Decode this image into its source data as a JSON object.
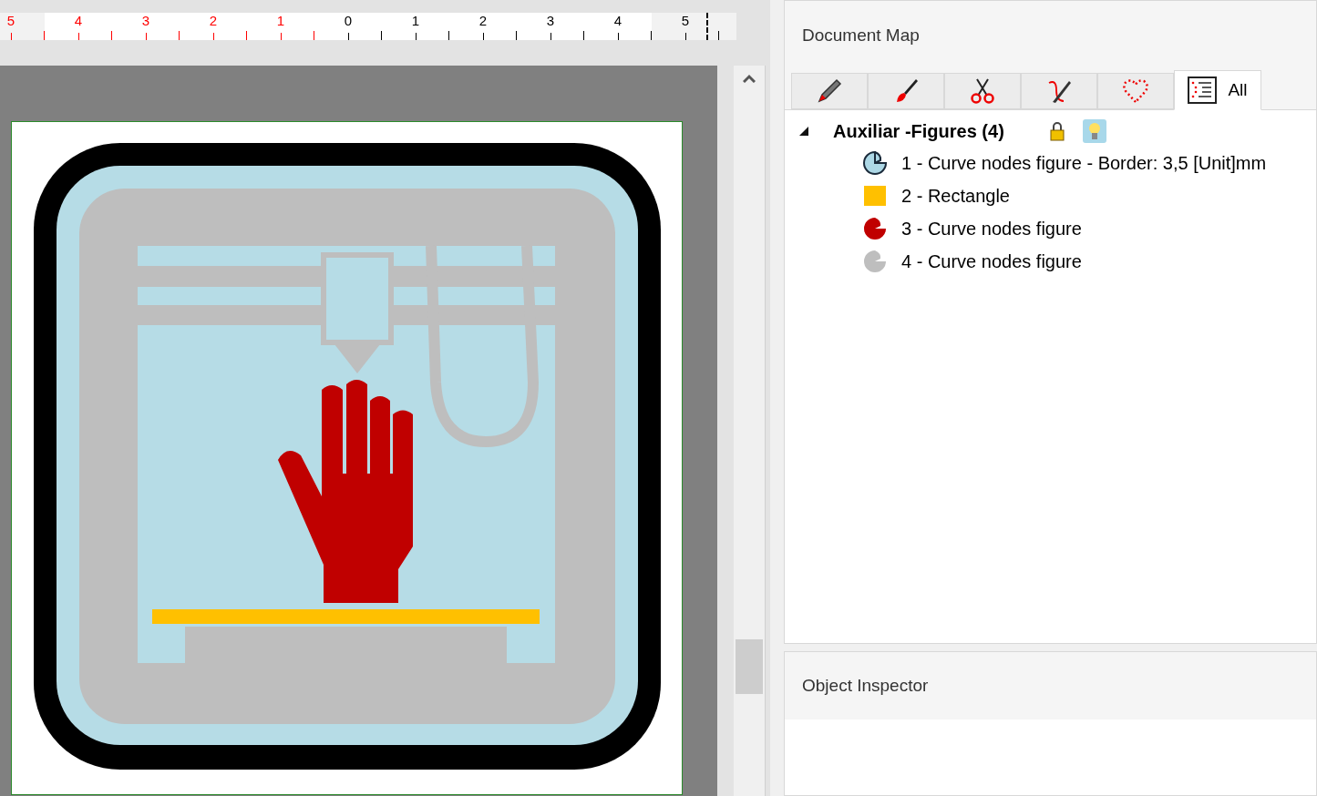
{
  "ruler": {
    "labels": [
      {
        "text": "5",
        "color": "#ff0000"
      },
      {
        "text": "4",
        "color": "#ff0000"
      },
      {
        "text": "3",
        "color": "#ff0000"
      },
      {
        "text": "2",
        "color": "#ff0000"
      },
      {
        "text": "1",
        "color": "#ff0000"
      },
      {
        "text": "0",
        "color": "#000000"
      },
      {
        "text": "1",
        "color": "#000000"
      },
      {
        "text": "2",
        "color": "#000000"
      },
      {
        "text": "3",
        "color": "#000000"
      },
      {
        "text": "4",
        "color": "#000000"
      },
      {
        "text": "5",
        "color": "#000000"
      }
    ]
  },
  "document_map": {
    "title": "Document Map",
    "tabs": [
      {
        "kind": "pencil",
        "selected": false
      },
      {
        "kind": "brush",
        "selected": false
      },
      {
        "kind": "scissors",
        "selected": false
      },
      {
        "kind": "knife",
        "selected": false
      },
      {
        "kind": "heart",
        "selected": false
      },
      {
        "kind": "list",
        "label": "All",
        "selected": true
      }
    ],
    "tree": [
      {
        "label": "Auxiliar -Figures (4)",
        "expanded": true,
        "locked": true,
        "visible": true,
        "children": [
          {
            "kind": "curve",
            "label": "1 - Curve nodes figure - Border: 3,5 [Unit]mm",
            "color": "#add8e6",
            "outlined": true
          },
          {
            "kind": "rect",
            "label": "2 - Rectangle",
            "color": "#ffc000",
            "outlined": false
          },
          {
            "kind": "curve",
            "label": "3 - Curve nodes figure",
            "color": "#c00000",
            "outlined": false
          },
          {
            "kind": "curve",
            "label": "4 - Curve nodes figure",
            "color": "#bebebe",
            "outlined": false
          }
        ]
      }
    ]
  },
  "object_inspector": {
    "title": "Object Inspector"
  }
}
